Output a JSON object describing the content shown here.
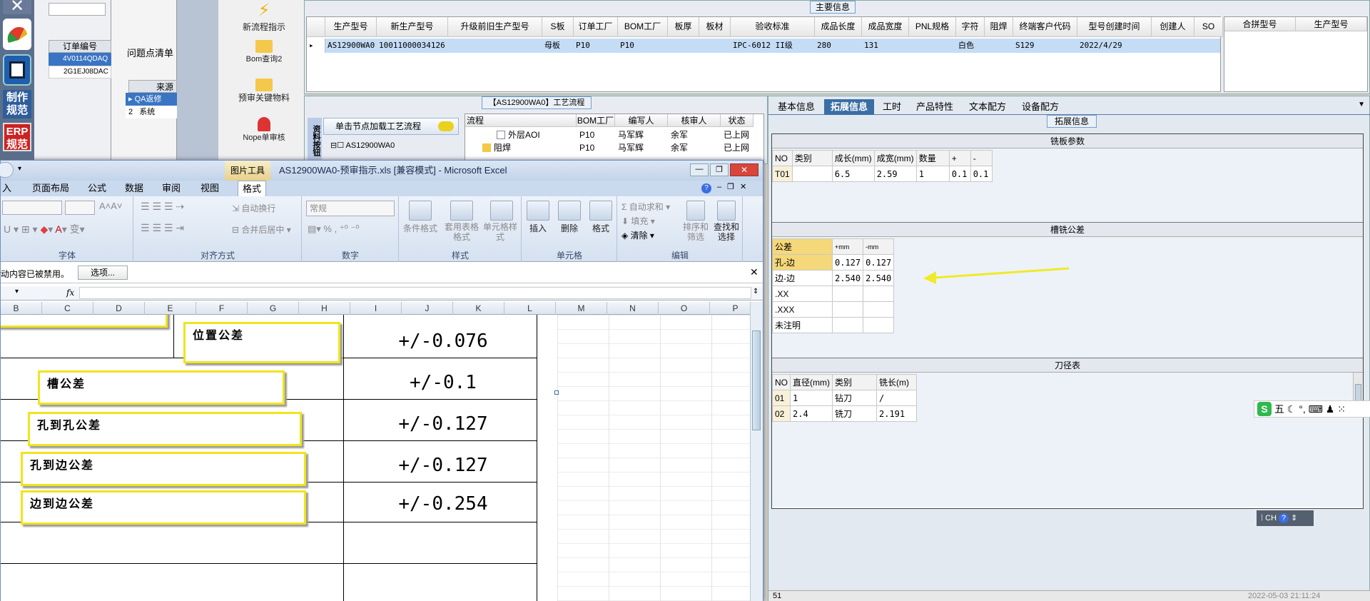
{
  "left_tools": {
    "item1_label": "制作规范",
    "item2_label": "ERP规范"
  },
  "order_panel": {
    "header": "订单编号",
    "rows": [
      "4V0114QDAQ",
      "2G1EJ08DAC"
    ]
  },
  "issue_panel": {
    "title": "问题点清单",
    "source_header": "来源",
    "rows": [
      {
        "no": "1",
        "label": "QA返修"
      },
      {
        "no": "2",
        "label": "系统"
      }
    ]
  },
  "nav_tools": {
    "new_flow": "新流程指示",
    "bom_query": "Bom查询2",
    "key_material": "预审关键物料",
    "nope_review": "Nope单审核"
  },
  "main_info": {
    "section_title": "主要信息",
    "headers": [
      "生产型号",
      "新生产型号",
      "升级前旧生产型号",
      "S板",
      "订单工厂",
      "BOM工厂",
      "板厚",
      "板材",
      "验收标准",
      "成品长度",
      "成品宽度",
      "PNL规格",
      "字符",
      "阻焊",
      "终端客户代码",
      "型号创建时间",
      "创建人",
      "SO"
    ],
    "row": [
      "AS12900WA0",
      "10011000034126",
      "",
      "母板",
      "P10",
      "P10",
      "",
      "",
      "IPC-6012 II级",
      "280",
      "131",
      "",
      "白色",
      "",
      "S129",
      "2022/4/29",
      "",
      ""
    ],
    "side_headers": [
      "合拼型号",
      "生产型号"
    ]
  },
  "process_flow": {
    "title": "【AS12900WA0】工艺流程",
    "vtab": "资料按钮",
    "load_hint": "单击节点加载工艺流程",
    "tree_root": "AS12900WA0",
    "headers": [
      "流程",
      "BOM工厂",
      "编写人",
      "核审人",
      "状态"
    ],
    "rows": [
      {
        "name": "外层AOI",
        "bom": "P10",
        "author": "马军辉",
        "reviewer": "余军",
        "status": "已上网"
      },
      {
        "name": "阻焊",
        "bom": "P10",
        "author": "马军辉",
        "reviewer": "余军",
        "status": "已上网"
      }
    ]
  },
  "detail_tabs": {
    "tabs": [
      "基本信息",
      "拓展信息",
      "工时",
      "产品特性",
      "文本配方",
      "设备配方"
    ],
    "active": "拓展信息",
    "section_title": "拓展信息"
  },
  "mill_params": {
    "title": "铣板参数",
    "headers": [
      "NO",
      "类别",
      "成长(mm)",
      "成宽(mm)",
      "数量",
      "+",
      "-"
    ],
    "rows": [
      [
        "T01",
        "",
        "6.5",
        "2.59",
        "1",
        "0.1",
        "0.1"
      ]
    ]
  },
  "slot_tolerance": {
    "title": "槽铣公差",
    "headers": [
      "公差",
      "+mm",
      "-mm"
    ],
    "rows": [
      [
        "孔-边",
        "0.127",
        "0.127"
      ],
      [
        "边-边",
        "2.540",
        "2.540"
      ],
      [
        ".XX",
        "",
        ""
      ],
      [
        ".XXX",
        "",
        ""
      ],
      [
        "未注明",
        "",
        ""
      ]
    ]
  },
  "tool_table": {
    "title": "刀径表",
    "headers": [
      "NO",
      "直径(mm)",
      "类别",
      "铣长(m)"
    ],
    "rows": [
      [
        "01",
        "1",
        "钻刀",
        "/"
      ],
      [
        "02",
        "2.4",
        "铣刀",
        "2.191"
      ]
    ]
  },
  "ime": {
    "label": "五",
    "lang": "CH"
  },
  "excel": {
    "context_tab": "图片工具",
    "title": "AS12900WA0-预审指示.xls [兼容模式] - Microsoft Excel",
    "menu": [
      "入",
      "页面布局",
      "公式",
      "数据",
      "审阅",
      "视图",
      "格式"
    ],
    "groups": [
      "字体",
      "对齐方式",
      "数字",
      "样式",
      "单元格",
      "编辑"
    ],
    "autowrap": "自动换行",
    "merge": "合并后居中",
    "number_format": "常规",
    "cond_format": "条件格式",
    "table_format": "套用表格格式",
    "cell_style": "单元格样式",
    "insert": "插入",
    "delete": "删除",
    "format": "格式",
    "autosum": "自动求和",
    "fill": "填充",
    "clear": "清除",
    "sort": "排序和筛选",
    "find": "查找和选择",
    "security_msg": "活动内容已被禁用。",
    "options_btn": "选项...",
    "fx": "fx",
    "columns": [
      "B",
      "C",
      "D",
      "E",
      "F",
      "G",
      "H",
      "I",
      "J",
      "K",
      "L",
      "M",
      "N",
      "O",
      "P"
    ],
    "tolerances": [
      {
        "label": "位置公差",
        "value": "+/-0.076"
      },
      {
        "label": "槽公差",
        "value": "+/-0.1"
      },
      {
        "label": "孔到孔公差",
        "value": "+/-0.127"
      },
      {
        "label": "孔到边公差",
        "value": "+/-0.127"
      },
      {
        "label": "边到边公差",
        "value": "+/-0.254"
      }
    ]
  },
  "status": {
    "left": "51",
    "right": "2022-05-03 21:11:24"
  },
  "colors": {
    "accent_blue": "#3a6ea5",
    "select": "#c5dcf5",
    "highlight_yellow": "#f5d87a",
    "arrow_yellow": "#f0ea28",
    "excel_title": "#c9d9ee"
  }
}
